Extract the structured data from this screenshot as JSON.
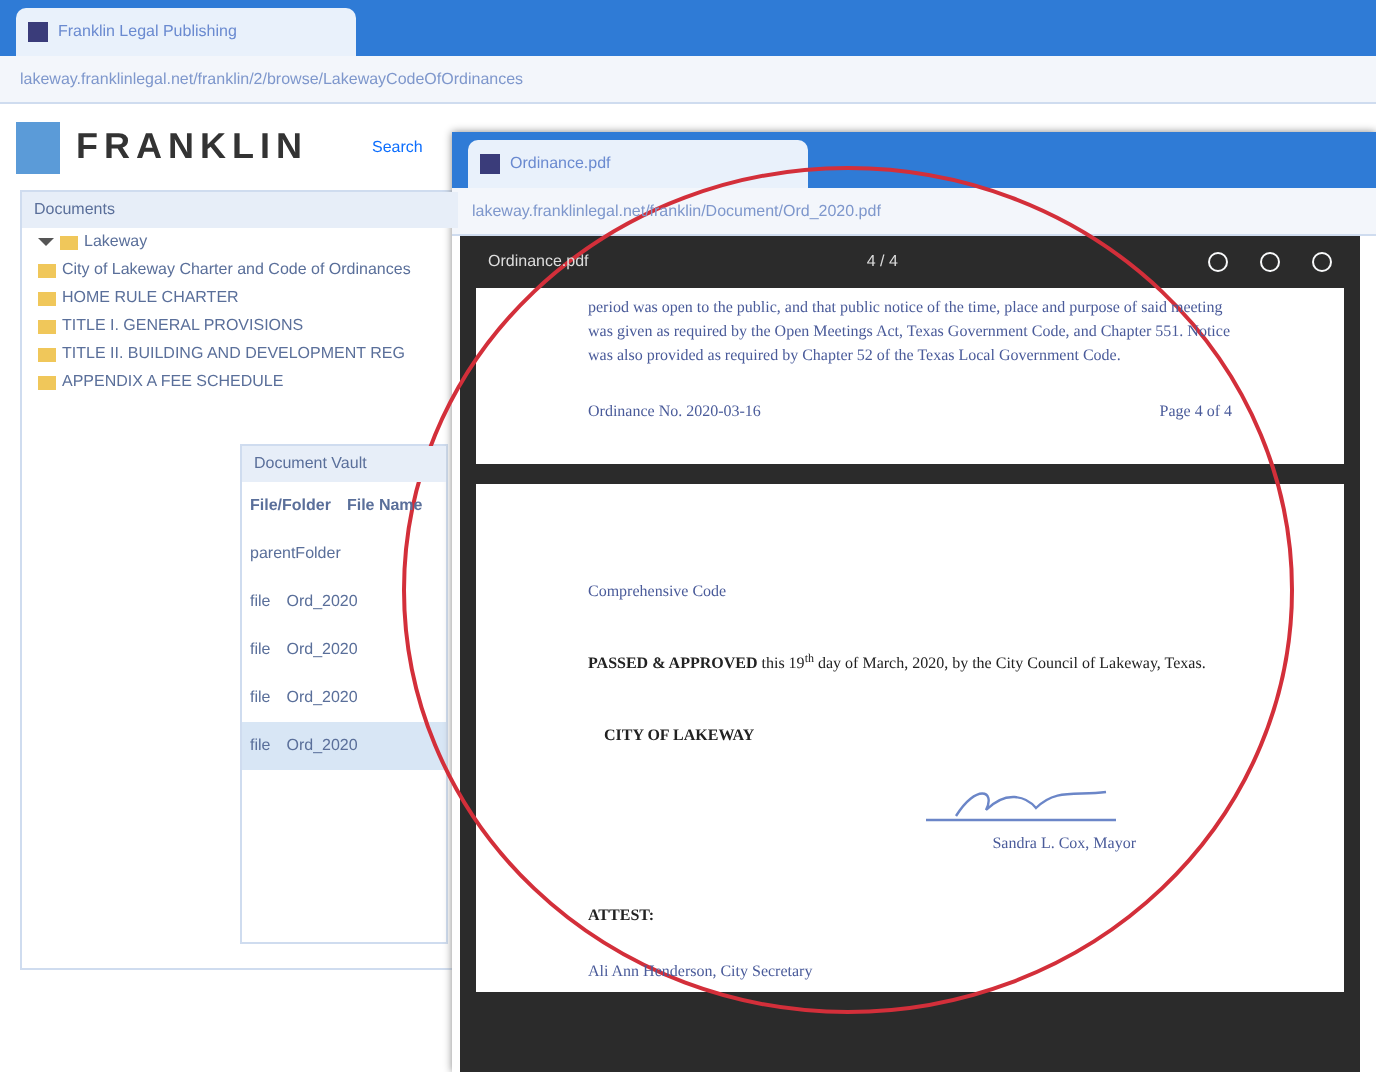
{
  "back_window": {
    "tab_title": "Franklin Legal Publishing",
    "address": "lakeway.franklinlegal.net/franklin/2/browse/LakewayCodeOfOrdinances",
    "logo": "FRANKLIN",
    "top_links": [
      "Search"
    ],
    "tree": {
      "label": "Lakeway",
      "expanded": true,
      "children": [
        {
          "label": "City of Lakeway Charter and Code of Ordinances"
        },
        {
          "label": "HOME RULE CHARTER"
        },
        {
          "label": "TITLE I. GENERAL PROVISIONS"
        },
        {
          "label": "TITLE II. BUILDING AND DEVELOPMENT REG"
        },
        {
          "label": "APPENDIX A FEE SCHEDULE"
        }
      ]
    },
    "panel_header": "Documents",
    "vault": {
      "title": "Document Vault",
      "columns": [
        "File/Folder",
        "File Name"
      ],
      "rows": [
        {
          "cells": [
            "parentFolder",
            ""
          ],
          "selected": false
        },
        {
          "cells": [
            "file",
            "Ord_2020"
          ],
          "selected": false
        },
        {
          "cells": [
            "file",
            "Ord_2020"
          ],
          "selected": false
        },
        {
          "cells": [
            "file",
            "Ord_2020"
          ],
          "selected": false
        },
        {
          "cells": [
            "file",
            "Ord_2020"
          ],
          "selected": true
        }
      ]
    }
  },
  "front_window": {
    "tab_title": "Ordinance.pdf",
    "address": "lakeway.franklinlegal.net/franklin/Document/Ord_2020.pdf",
    "viewer": {
      "file_name": "Ordinance.pdf",
      "page_counter": "4 / 4"
    },
    "page_top": {
      "paragraph": "period was open to the public, and that public notice of the time, place and purpose of said meeting was given as required by the Open Meetings Act, Texas Government Code, and Chapter 551. Notice was also provided as required by Chapter 52 of the Texas Local Government Code.",
      "footer_left": "Ordinance No. 2020-03-16",
      "footer_right": "Page 4 of 4"
    },
    "page_bottom": {
      "heading": "Comprehensive Code",
      "paragraph": "**PASSED & APPROVED** this 19$^{th}$ day of March, 2020, by the City Council of Lakeway, Texas.",
      "city": "CITY OF LAKEWAY",
      "signer": "Sandra L. Cox, Mayor",
      "attest": "ATTEST:",
      "clerk": "Ali Ann Henderson, City Secretary"
    }
  }
}
